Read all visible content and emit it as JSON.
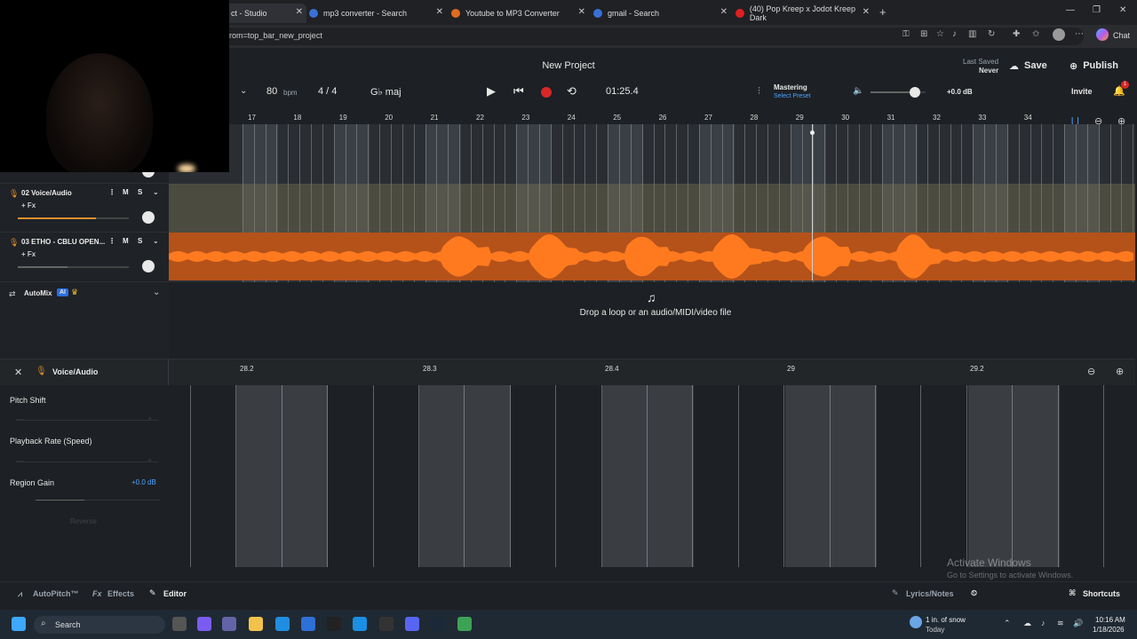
{
  "browser": {
    "tabs": [
      {
        "label": "ct - Studio",
        "icon": "bandlab-icon"
      },
      {
        "label": "mp3 converter - Search",
        "icon": "search-icon"
      },
      {
        "label": "Youtube to MP3 Converter",
        "icon": "converter-icon"
      },
      {
        "label": "gmail - Search",
        "icon": "search-icon"
      },
      {
        "label": "(40) Pop Kreep x Jodot Kreep Dark",
        "icon": "youtube-icon"
      }
    ],
    "close_glyph": "✕",
    "new_tab_glyph": "+",
    "url": "rom=top_bar_new_project",
    "chat_label": "Chat"
  },
  "header": {
    "project_title": "New Project",
    "last_saved_label": "Last Saved",
    "last_saved_value": "Never",
    "save_label": "Save",
    "publish_label": "Publish",
    "invite_label": "Invite",
    "notification_count": "1"
  },
  "transport": {
    "bpm_value": "80",
    "bpm_unit": "bpm",
    "time_signature": "4 / 4",
    "key": "G♭ maj",
    "time_display": "01:25.4",
    "mastering_label": "Mastering",
    "mastering_preset": "Select Preset",
    "volume_db": "+0.0 dB",
    "volume_level_pct": 80
  },
  "ruler": {
    "bars": [
      "17",
      "18",
      "19",
      "20",
      "21",
      "22",
      "23",
      "24",
      "25",
      "26",
      "27",
      "28",
      "29",
      "30",
      "31",
      "32",
      "33",
      "34"
    ]
  },
  "tracks": [
    {
      "name": "02  Voice/Audio",
      "fx": "+ Fx",
      "mute": "M",
      "solo": "S",
      "fader_pct": 70
    },
    {
      "name": "03  ETHO - CBLU OPEN...",
      "fx": "+ Fx",
      "mute": "M",
      "solo": "S",
      "fader_pct": 45
    }
  ],
  "automix": {
    "label": "AutoMix",
    "badge": "AI"
  },
  "dropzone": {
    "text": "Drop a loop or an audio/MIDI/video file"
  },
  "editor": {
    "title": "Voice/Audio",
    "ruler": [
      "28.2",
      "28.3",
      "28.4",
      "29",
      "29.2"
    ],
    "pitch_shift": "Pitch Shift",
    "playback_rate": "Playback Rate (Speed)",
    "region_gain": "Region Gain",
    "region_gain_value": "+0.0 dB",
    "reverse": "Reverse"
  },
  "bottom_bar": {
    "autopitch": "AutoPitch™",
    "effects": "Effects",
    "editor": "Editor",
    "lyrics": "Lyrics/Notes",
    "shortcuts": "Shortcuts"
  },
  "watermark": {
    "title": "Activate Windows",
    "subtitle": "Go to Settings to activate Windows."
  },
  "taskbar": {
    "search": "Search",
    "weather": "1 in. of snow",
    "weather_sub": "Today",
    "time": "10:16 AM",
    "date": "1/18/2026"
  }
}
